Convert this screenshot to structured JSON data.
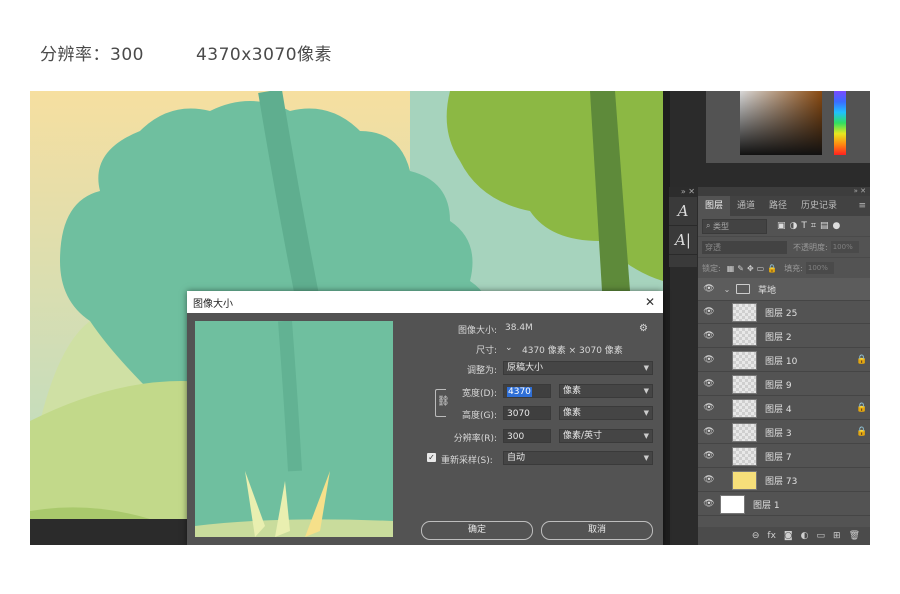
{
  "caption": {
    "resolution": "分辨率：300",
    "pixels": "4370x3070像素"
  },
  "tools": {
    "char_icon": "A",
    "para_icon": "A|",
    "top_controls": "» ✕"
  },
  "layers_panel": {
    "grip": "» ✕",
    "tabs": [
      "图层",
      "通道",
      "路径",
      "历史记录"
    ],
    "menu": "≡",
    "filter_placeholder": "类型",
    "blend_mode": "穿透",
    "opacity_label": "不透明度:",
    "opacity_value": "100%",
    "lock_label": "锁定:",
    "fill_label": "填充:",
    "fill_value": "100%",
    "group": {
      "name": "草地",
      "chevron": "⌄"
    },
    "layers": [
      {
        "name": "图层 25",
        "locked": false
      },
      {
        "name": "图层 2",
        "locked": false
      },
      {
        "name": "图层 10",
        "locked": true
      },
      {
        "name": "图层 9",
        "locked": false
      },
      {
        "name": "图层 4",
        "locked": true
      },
      {
        "name": "图层 3",
        "locked": true
      },
      {
        "name": "图层 7",
        "locked": false
      },
      {
        "name": "图层 73",
        "locked": false
      },
      {
        "name": "图层 1",
        "locked": false
      }
    ],
    "footer_icons": [
      "link-icon",
      "fx-icon",
      "mask-icon",
      "adjustment-icon",
      "folder-icon",
      "new-layer-icon",
      "trash-icon"
    ],
    "footer_labels": [
      "⊖",
      "fx",
      "◙",
      "◐",
      "▭",
      "⊞",
      "🗑"
    ]
  },
  "dialog": {
    "title": "图像大小",
    "close": "✕",
    "image_size_label": "图像大小:",
    "image_size_value": "38.4M",
    "dimensions_label": "尺寸:",
    "dimensions_value": "4370 像素  ×  3070 像素",
    "fit_label": "调整为:",
    "fit_value": "原稿大小",
    "width_label": "宽度(D):",
    "width_value": "4370",
    "width_unit": "像素",
    "height_label": "高度(G):",
    "height_value": "3070",
    "height_unit": "像素",
    "resolution_label": "分辨率(R):",
    "resolution_value": "300",
    "resolution_unit": "像素/英寸",
    "resample_label": "重新采样(S):",
    "resample_value": "自动",
    "resample_checked": true,
    "ok_label": "确定",
    "cancel_label": "取消"
  },
  "colors": {
    "canvas_sky": "#bcdcc6",
    "tree_main": "#6fbf9f",
    "tree_light": "#c9dc9c",
    "tree_right": "#8cb844",
    "trunk": "#5e8a3a",
    "ui_panel": "#535353",
    "ui_dark": "#2b2b2b",
    "selection_blue": "#2f6fd6"
  }
}
